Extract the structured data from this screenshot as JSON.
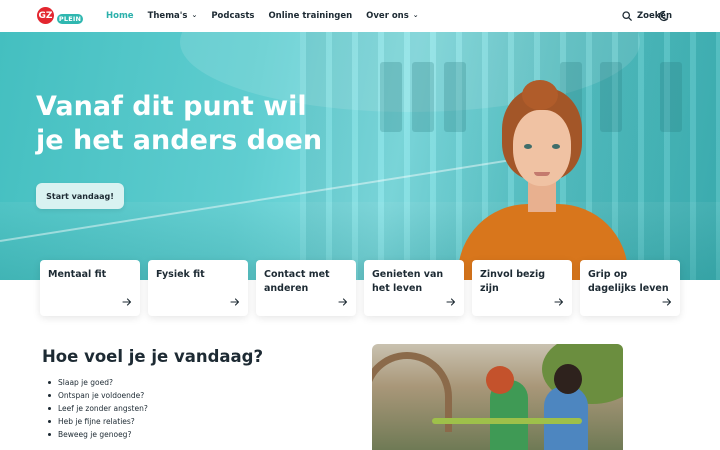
{
  "nav": {
    "logo_letters": "GZ",
    "logo_badge": "PLEIN",
    "links": [
      {
        "label": "Home",
        "active": true,
        "dropdown": false
      },
      {
        "label": "Thema's",
        "active": false,
        "dropdown": true
      },
      {
        "label": "Podcasts",
        "active": false,
        "dropdown": false
      },
      {
        "label": "Online trainingen",
        "active": false,
        "dropdown": false
      },
      {
        "label": "Over ons",
        "active": false,
        "dropdown": true
      }
    ],
    "search_label": "Zoeken",
    "search_icon": "search-icon",
    "theme_icon": "moon-icon"
  },
  "hero": {
    "title_line1": "Vanaf dit punt wil",
    "title_line2": "je het anders doen",
    "cta_label": "Start vandaag!"
  },
  "cards": [
    {
      "line1": "Mentaal fit",
      "line2": ""
    },
    {
      "line1": "Fysiek fit",
      "line2": ""
    },
    {
      "line1": "Contact met",
      "line2": "anderen"
    },
    {
      "line1": "Genieten van",
      "line2": "het leven"
    },
    {
      "line1": "Zinvol bezig zijn",
      "line2": ""
    },
    {
      "line1": "Grip op",
      "line2": "dagelijks leven"
    }
  ],
  "feel": {
    "title": "Hoe voel je je vandaag?",
    "items": [
      "Slaap je goed?",
      "Ontspan je voldoende?",
      "Leef je zonder angsten?",
      "Heb je fijne relaties?",
      "Beweeg je genoeg?"
    ]
  },
  "colors": {
    "accent": "#2bb0ab",
    "logo_red": "#e3262f",
    "text": "#1d2a33"
  }
}
